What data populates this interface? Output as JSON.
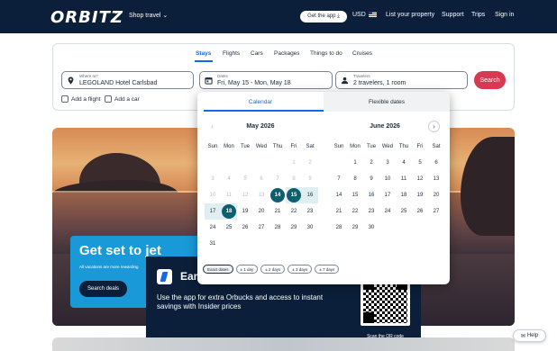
{
  "header": {
    "logo": "ORBITZ",
    "shop_travel": "Shop travel ⌄",
    "get_app": "Get the app ⤓",
    "currency": "USD",
    "list_property": "List your property",
    "support": "Support",
    "trips": "Trips",
    "sign_in": "Sign in"
  },
  "search": {
    "tabs": [
      "Stays",
      "Flights",
      "Cars",
      "Packages",
      "Things to do",
      "Cruises"
    ],
    "active_tab": "Stays",
    "where_label": "Where to?",
    "where_value": "LEGOLAND Hotel Carlsbad",
    "dates_label": "Dates",
    "dates_value": "Fri, May 15 - Mon, May 18",
    "travelers_label": "Travelers",
    "travelers_value": "2 travelers, 1 room",
    "search_button": "Search",
    "add_flight": "Add a flight",
    "add_car": "Add a car"
  },
  "hero": {
    "title": "Get set to jet",
    "subtitle": "All vacations are more rewarding",
    "button": "Search deals"
  },
  "app_promo": {
    "title": "Earn",
    "text": "Use the app for extra Orbucks and access to instant savings with Insider prices",
    "qr_caption": "Scan the QR code"
  },
  "help": "Help",
  "picker": {
    "tabs": [
      "Calendar",
      "Flexible dates"
    ],
    "active_tab": "Calendar",
    "weekdays": [
      "Sun",
      "Mon",
      "Tue",
      "Wed",
      "Thu",
      "Fri",
      "Sat"
    ],
    "month1": {
      "title": "May 2026",
      "weeks": [
        [
          "",
          "",
          "",
          "",
          "",
          "1",
          "2"
        ],
        [
          "3",
          "4",
          "5",
          "6",
          "7",
          "8",
          "9"
        ],
        [
          "10",
          "11",
          "12",
          "13",
          "14",
          "15",
          "16"
        ],
        [
          "17",
          "18",
          "19",
          "20",
          "21",
          "22",
          "23"
        ],
        [
          "24",
          "25",
          "26",
          "27",
          "28",
          "29",
          "30"
        ],
        [
          "31",
          "",
          "",
          "",
          "",
          "",
          ""
        ]
      ],
      "muted_before": 14,
      "today": 14,
      "start": 15,
      "end": 18
    },
    "month2": {
      "title": "June 2026",
      "weeks": [
        [
          "",
          "1",
          "2",
          "3",
          "4",
          "5",
          "6"
        ],
        [
          "7",
          "8",
          "9",
          "10",
          "11",
          "12",
          "13"
        ],
        [
          "14",
          "15",
          "16",
          "17",
          "18",
          "19",
          "20"
        ],
        [
          "21",
          "22",
          "23",
          "24",
          "25",
          "26",
          "27"
        ],
        [
          "28",
          "29",
          "30",
          "",
          "",
          "",
          ""
        ]
      ]
    },
    "flex_chips": [
      "Exact dates",
      "± 1 day",
      "± 2 days",
      "± 3 days",
      "± 7 days"
    ],
    "active_chip": "Exact dates"
  }
}
